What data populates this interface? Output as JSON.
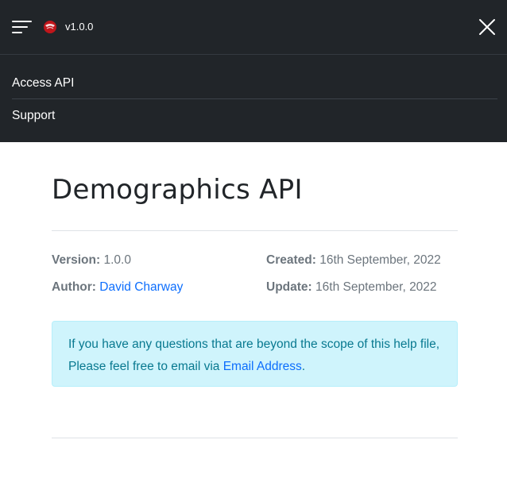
{
  "header": {
    "version": "v1.0.0",
    "menu_icon": "hamburger-menu-icon",
    "logo_icon": "red-ruby-logo-icon",
    "close_icon": "close-icon"
  },
  "nav": {
    "items": [
      {
        "label": "Access API"
      },
      {
        "label": "Support"
      }
    ]
  },
  "page": {
    "title": "Demographics API"
  },
  "meta": {
    "version_label": "Version:",
    "version_value": "1.0.0",
    "author_label": "Author:",
    "author_value": "David Charway",
    "created_label": "Created:",
    "created_value": "16th September, 2022",
    "update_label": "Update:",
    "update_value": "16th September, 2022"
  },
  "alert": {
    "text": "If you have any questions that are beyond the scope of this help file, Please feel free to email via",
    "link_text": "Email Address",
    "trailing": "."
  },
  "colors": {
    "header_bg": "#212529",
    "link": "#0d6efd",
    "alert_bg": "#cff4fc",
    "alert_text": "#087990"
  }
}
